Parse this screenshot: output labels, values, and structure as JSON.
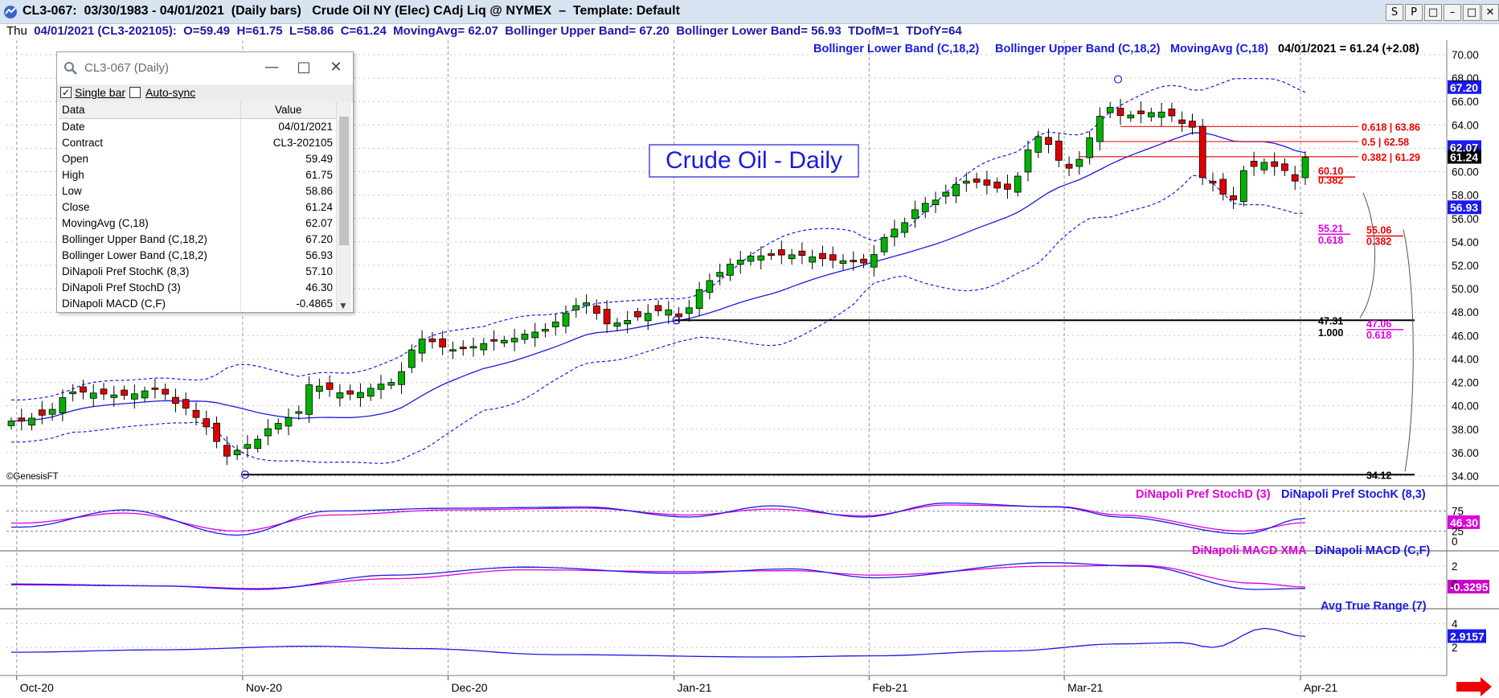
{
  "window": {
    "title": "CL3-067:  03/30/1983 - 04/01/2021  (Daily bars)   Crude Oil NY (Elec) CAdj Liq @ NYMEX  –  Template: Default",
    "buttons": [
      "S",
      "P",
      "□",
      "–",
      "□",
      "✕"
    ]
  },
  "infobar": {
    "day": "Thu",
    "text": "  04/01/2021 (CL3-202105):  O=59.49  H=61.75  L=58.86  C=61.24  MovingAvg= 62.07  Bollinger Upper Band= 67.20  Bollinger Lower Band= 56.93  TDofM=1  TDofY=64"
  },
  "colors": {
    "up_candle": "#00b200",
    "down_candle": "#dd0000",
    "band": "#1a1ae0",
    "magenta": "#dd00dd",
    "fib_red": "#ee0000",
    "price_label_bg": "#1a1aee",
    "grid": "#c8c8c8"
  },
  "datawindow": {
    "title": "CL3-067 (Daily)",
    "single_bar_label": "Single bar",
    "auto_sync_label": "Auto-sync",
    "header": [
      "Data",
      "Value"
    ],
    "rows": [
      [
        "Date",
        "04/01/2021"
      ],
      [
        "Contract",
        "CL3-202105"
      ],
      [
        "Open",
        "59.49"
      ],
      [
        "High",
        "61.75"
      ],
      [
        "Low",
        "58.86"
      ],
      [
        "Close",
        "61.24"
      ],
      [
        "MovingAvg (C,18)",
        "62.07"
      ],
      [
        "Bollinger Upper Band (C,18,2)",
        "67.20"
      ],
      [
        "Bollinger Lower Band (C,18,2)",
        "56.93"
      ],
      [
        "DiNapoli Pref StochK (8,3)",
        "57.10"
      ],
      [
        "DiNapoli Pref StochD (3)",
        "46.30"
      ],
      [
        "DiNapoli MACD (C,F)",
        "-0.4865"
      ]
    ]
  },
  "chart_data": {
    "type": "candlestick",
    "title": "Crude Oil - Daily",
    "watermark": "©GenesisFT",
    "x_ticks": [
      "Oct-20",
      "Nov-20",
      "Dec-20",
      "Jan-21",
      "Feb-21",
      "Mar-21",
      "Apr-21"
    ],
    "price_axis": {
      "ylim": [
        34,
        70
      ],
      "ticks": [
        34,
        36,
        38,
        40,
        42,
        44,
        46,
        48,
        50,
        52,
        54,
        56,
        58,
        60,
        62,
        64,
        66,
        68,
        70
      ]
    },
    "legend_top": [
      "Bollinger Lower Band (C,18,2)",
      "Bollinger Upper Band (C,18,2)",
      "MovingAvg (C,18)"
    ],
    "last_value_text": "04/01/2021 = 61.24 (+2.08)",
    "axis_tags": [
      {
        "text": "67.20",
        "value": 67.2,
        "color": "#1a1aee"
      },
      {
        "text": "62.07",
        "value": 62.07,
        "color": "#1a1aee"
      },
      {
        "text": "61.24",
        "value": 61.24,
        "color": "#000000"
      },
      {
        "text": "56.93",
        "value": 56.93,
        "color": "#1a1aee"
      }
    ],
    "close_anchors": [
      [
        "2020-10-01",
        38.7
      ],
      [
        "2020-10-05",
        39.2
      ],
      [
        "2020-10-08",
        41.2
      ],
      [
        "2020-10-15",
        40.9
      ],
      [
        "2020-10-20",
        41.4
      ],
      [
        "2020-10-23",
        39.8
      ],
      [
        "2020-10-27",
        38.2
      ],
      [
        "2020-10-29",
        35.7
      ],
      [
        "2020-11-02",
        36.7
      ],
      [
        "2020-11-05",
        38.5
      ],
      [
        "2020-11-09",
        39.5
      ],
      [
        "2020-11-10",
        41.8
      ],
      [
        "2020-11-16",
        41.0
      ],
      [
        "2020-11-20",
        42.0
      ],
      [
        "2020-11-25",
        45.7
      ],
      [
        "2020-12-01",
        44.8
      ],
      [
        "2020-12-08",
        45.6
      ],
      [
        "2020-12-11",
        46.3
      ],
      [
        "2020-12-18",
        48.8
      ],
      [
        "2020-12-22",
        47.0
      ],
      [
        "2020-12-31",
        48.2
      ],
      [
        "2021-01-04",
        47.6
      ],
      [
        "2021-01-07",
        50.7
      ],
      [
        "2021-01-11",
        52.1
      ],
      [
        "2021-01-13",
        52.8
      ],
      [
        "2021-01-20",
        52.9
      ],
      [
        "2021-01-27",
        52.4
      ],
      [
        "2021-01-29",
        52.2
      ],
      [
        "2021-02-03",
        55.1
      ],
      [
        "2021-02-08",
        57.3
      ],
      [
        "2021-02-12",
        59.2
      ],
      [
        "2021-02-19",
        58.5
      ],
      [
        "2021-02-24",
        63.0
      ],
      [
        "2021-03-01",
        60.3
      ],
      [
        "2021-03-05",
        65.5
      ],
      [
        "2021-03-08",
        64.8
      ],
      [
        "2021-03-12",
        65.1
      ],
      [
        "2021-03-17",
        63.8
      ],
      [
        "2021-03-18",
        59.5
      ],
      [
        "2021-03-23",
        57.6
      ],
      [
        "2021-03-24",
        60.1
      ],
      [
        "2021-03-26",
        60.8
      ],
      [
        "2021-03-30",
        60.1
      ],
      [
        "2021-03-31",
        59.2
      ],
      [
        "2021-04-01",
        61.24
      ]
    ],
    "last_bar": {
      "date": "04/01/2021",
      "open": 59.49,
      "high": 61.75,
      "low": 58.86,
      "close": 61.24
    },
    "horizontal_lines": [
      {
        "value": 47.31,
        "from": "2021-01-04",
        "color": "#000000"
      },
      {
        "value": 34.12,
        "from": "2020-11-02",
        "color": "#000000"
      }
    ],
    "fib_lines": [
      {
        "text": "0.618 | 63.86",
        "value": 63.86,
        "from": "2021-03-08"
      },
      {
        "text": "0.5 | 62.58",
        "value": 62.58,
        "from": "2021-03-04"
      },
      {
        "text": "0.382 | 61.29",
        "value": 61.29,
        "from": "2021-03-02"
      }
    ],
    "text_labels": [
      {
        "text": "60.10",
        "value": 60.1,
        "col": "a",
        "color": "#ee0000"
      },
      {
        "text": "0.382",
        "value": 59.3,
        "col": "a",
        "color": "#ee0000"
      },
      {
        "text": "55.21",
        "value": 55.21,
        "col": "a2",
        "color": "#dd00dd"
      },
      {
        "text": "0.618",
        "value": 54.2,
        "col": "a2",
        "color": "#dd00dd"
      },
      {
        "text": "55.06",
        "value": 55.06,
        "col": "b",
        "color": "#ee0000"
      },
      {
        "text": "0.382",
        "value": 54.1,
        "col": "b",
        "color": "#ee0000"
      },
      {
        "text": "47.31",
        "value": 47.31,
        "col": "c",
        "color": "#000000"
      },
      {
        "text": "1.000",
        "value": 46.3,
        "col": "c",
        "color": "#000000"
      },
      {
        "text": "47.06",
        "value": 47.06,
        "col": "b",
        "color": "#dd00dd"
      },
      {
        "text": "0.618",
        "value": 46.1,
        "col": "b",
        "color": "#dd00dd"
      },
      {
        "text": "34.12",
        "value": 34.12,
        "col": "d",
        "color": "#000000"
      }
    ],
    "stoch_panel": {
      "legend": [
        "DiNapoli Pref StochD (3)",
        "DiNapoli Pref StochK (8,3)"
      ],
      "ticks": [
        0,
        25,
        75
      ],
      "ylim": [
        0,
        100
      ],
      "levels": [
        25,
        75
      ],
      "tag": {
        "text": "46.30",
        "value": 46.3
      },
      "k_anchors": [
        [
          "2020-10-01",
          35
        ],
        [
          "2020-10-15",
          78
        ],
        [
          "2020-10-30",
          15
        ],
        [
          "2020-11-12",
          75
        ],
        [
          "2020-12-01",
          82
        ],
        [
          "2020-12-18",
          85
        ],
        [
          "2021-01-05",
          60
        ],
        [
          "2021-01-15",
          88
        ],
        [
          "2021-01-29",
          60
        ],
        [
          "2021-02-10",
          95
        ],
        [
          "2021-02-26",
          85
        ],
        [
          "2021-03-08",
          60
        ],
        [
          "2021-03-24",
          18
        ],
        [
          "2021-04-01",
          57.1
        ]
      ],
      "d_anchors": [
        [
          "2020-10-01",
          45
        ],
        [
          "2020-10-15",
          70
        ],
        [
          "2020-10-30",
          25
        ],
        [
          "2020-11-12",
          65
        ],
        [
          "2020-12-01",
          78
        ],
        [
          "2020-12-18",
          82
        ],
        [
          "2021-01-05",
          65
        ],
        [
          "2021-01-15",
          80
        ],
        [
          "2021-01-29",
          63
        ],
        [
          "2021-02-10",
          90
        ],
        [
          "2021-02-26",
          86
        ],
        [
          "2021-03-08",
          65
        ],
        [
          "2021-03-24",
          25
        ],
        [
          "2021-04-01",
          46.3
        ]
      ]
    },
    "macd_panel": {
      "legend": [
        "DiNapoli MACD XMA",
        "DiNapoli MACD (C,F)"
      ],
      "ticks": [
        0,
        2
      ],
      "ylim": [
        -1.5,
        3
      ],
      "tag": {
        "text": "-0.3295",
        "value": -0.3295
      },
      "macd_anchors": [
        [
          "2020-10-01",
          0.0
        ],
        [
          "2020-10-20",
          -0.2
        ],
        [
          "2020-11-03",
          -0.6
        ],
        [
          "2020-11-20",
          1.0
        ],
        [
          "2020-12-10",
          1.9
        ],
        [
          "2021-01-04",
          1.2
        ],
        [
          "2021-01-20",
          1.7
        ],
        [
          "2021-02-01",
          0.7
        ],
        [
          "2021-02-25",
          2.4
        ],
        [
          "2021-03-10",
          2.0
        ],
        [
          "2021-03-25",
          -0.6
        ],
        [
          "2021-04-01",
          -0.49
        ]
      ],
      "xma_anchors": [
        [
          "2020-10-01",
          -0.1
        ],
        [
          "2020-10-20",
          -0.2
        ],
        [
          "2020-11-03",
          -0.5
        ],
        [
          "2020-11-20",
          0.6
        ],
        [
          "2020-12-10",
          1.6
        ],
        [
          "2021-01-04",
          1.4
        ],
        [
          "2021-01-20",
          1.5
        ],
        [
          "2021-02-01",
          1.0
        ],
        [
          "2021-02-25",
          2.0
        ],
        [
          "2021-03-10",
          2.1
        ],
        [
          "2021-03-25",
          0.1
        ],
        [
          "2021-04-01",
          -0.33
        ]
      ]
    },
    "atr_panel": {
      "legend": [
        "Avg True Range (7)"
      ],
      "ticks": [
        2,
        4
      ],
      "ylim": [
        1,
        4.5
      ],
      "tag": {
        "text": "2.9157",
        "value": 2.9157
      },
      "atr_anchors": [
        [
          "2020-10-01",
          1.6
        ],
        [
          "2020-10-20",
          1.8
        ],
        [
          "2020-11-10",
          2.1
        ],
        [
          "2020-11-25",
          1.9
        ],
        [
          "2020-12-15",
          1.4
        ],
        [
          "2021-01-15",
          1.2
        ],
        [
          "2021-02-01",
          1.3
        ],
        [
          "2021-02-20",
          1.7
        ],
        [
          "2021-03-08",
          2.3
        ],
        [
          "2021-03-16",
          2.4
        ],
        [
          "2021-03-20",
          2.0
        ],
        [
          "2021-03-26",
          3.6
        ],
        [
          "2021-04-01",
          2.92
        ]
      ]
    }
  }
}
